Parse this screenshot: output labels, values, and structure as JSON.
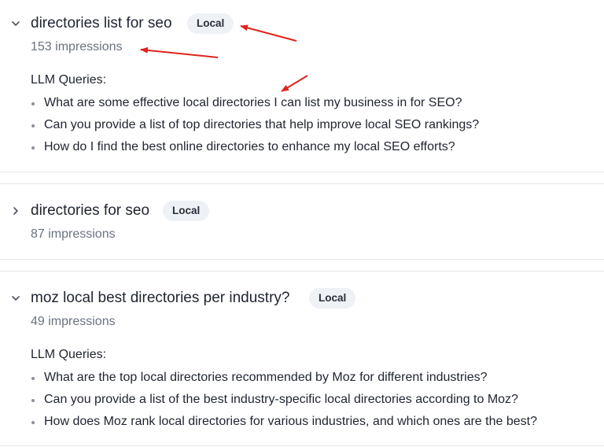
{
  "items": [
    {
      "keyword": "directories list for seo",
      "badge": "Local",
      "impressions": "153 impressions",
      "expanded": true,
      "llm_label": "LLM Queries:",
      "queries": [
        "What are some effective local directories I can list my business in for SEO?",
        "Can you provide a list of top directories that help improve local SEO rankings?",
        "How do I find the best online directories to enhance my local SEO efforts?"
      ]
    },
    {
      "keyword": "directories for seo",
      "badge": "Local",
      "impressions": "87 impressions",
      "expanded": false
    },
    {
      "keyword": "moz local best directories per industry?",
      "badge": "Local",
      "impressions": "49 impressions",
      "expanded": true,
      "llm_label": "LLM Queries:",
      "queries": [
        "What are the top local directories recommended by Moz for different industries?",
        "Can you provide a list of the best industry-specific local directories according to Moz?",
        "How does Moz rank local directories for various industries, and which ones are the best?"
      ]
    }
  ],
  "annotation_color": "#e0241b"
}
